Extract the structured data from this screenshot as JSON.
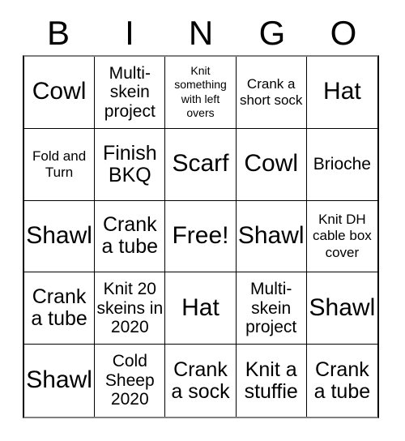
{
  "card": {
    "title": "BINGO",
    "header_letters": [
      "B",
      "I",
      "N",
      "G",
      "O"
    ],
    "grid": {
      "columns": 5,
      "rows": 5,
      "free_space_label": "Free!",
      "cells": [
        [
          {
            "text": "Cowl",
            "size": "lg"
          },
          {
            "text": "Multi-skein project",
            "size": "sm"
          },
          {
            "text": "Knit something with left overs",
            "size": "xxs"
          },
          {
            "text": "Crank a short sock",
            "size": "xs"
          },
          {
            "text": "Hat",
            "size": "lg"
          }
        ],
        [
          {
            "text": "Fold and Turn",
            "size": "xs"
          },
          {
            "text": "Finish BKQ",
            "size": "md"
          },
          {
            "text": "Scarf",
            "size": "lg"
          },
          {
            "text": "Cowl",
            "size": "lg"
          },
          {
            "text": "Brioche",
            "size": "sm"
          }
        ],
        [
          {
            "text": "Shawl",
            "size": "lg"
          },
          {
            "text": "Crank a tube",
            "size": "md"
          },
          {
            "text": "Free!",
            "size": "lg"
          },
          {
            "text": "Shawl",
            "size": "lg"
          },
          {
            "text": "Knit DH cable box cover",
            "size": "xs"
          }
        ],
        [
          {
            "text": "Crank a tube",
            "size": "md"
          },
          {
            "text": "Knit 20 skeins in 2020",
            "size": "sm"
          },
          {
            "text": "Hat",
            "size": "lg"
          },
          {
            "text": "Multi-skein project",
            "size": "sm"
          },
          {
            "text": "Shawl",
            "size": "lg"
          }
        ],
        [
          {
            "text": "Shawl",
            "size": "lg"
          },
          {
            "text": "Cold Sheep 2020",
            "size": "sm"
          },
          {
            "text": "Crank a sock",
            "size": "md"
          },
          {
            "text": "Knit a stuffie",
            "size": "md"
          },
          {
            "text": "Crank a tube",
            "size": "md"
          }
        ]
      ]
    },
    "colors": {
      "background": "#ffffff",
      "text": "#000000",
      "grid_line": "#000000",
      "outer_border": "#808080"
    }
  }
}
